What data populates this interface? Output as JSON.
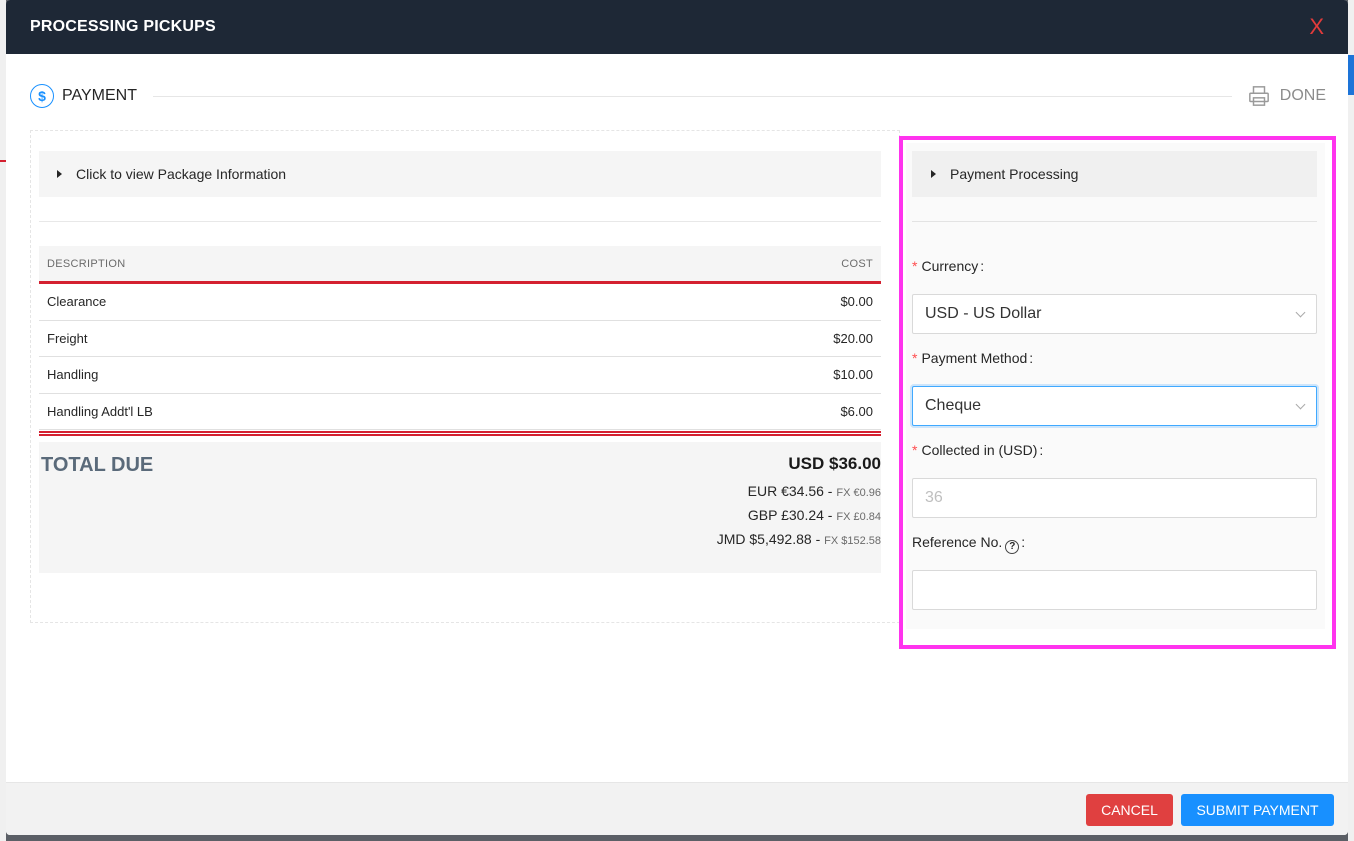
{
  "modal": {
    "title": "PROCESSING PICKUPS",
    "close_label": "X"
  },
  "steps": {
    "current_label": "PAYMENT",
    "current_icon": "dollar-icon",
    "done_label": "DONE",
    "done_icon": "printer-icon"
  },
  "package_info": {
    "header": "Click to view Package Information"
  },
  "table": {
    "columns": [
      "DESCRIPTION",
      "COST"
    ],
    "rows": [
      {
        "description": "Clearance",
        "cost": "$0.00"
      },
      {
        "description": "Freight",
        "cost": "$20.00"
      },
      {
        "description": "Handling",
        "cost": "$10.00"
      },
      {
        "description": "Handling Addt'l LB",
        "cost": "$6.00"
      }
    ]
  },
  "totals": {
    "label": "TOTAL DUE",
    "main": "USD $36.00",
    "fx": [
      {
        "amount": "EUR €34.56 -",
        "rate": "FX €0.96"
      },
      {
        "amount": "GBP £30.24 -",
        "rate": "FX £0.84"
      },
      {
        "amount": "JMD $5,492.88 -",
        "rate": "FX $152.58"
      }
    ]
  },
  "payment": {
    "header": "Payment Processing",
    "currency_label": "Currency",
    "currency_value": "USD - US Dollar",
    "method_label": "Payment Method",
    "method_value": "Cheque",
    "collected_label": "Collected in (USD)",
    "collected_placeholder": "36",
    "reference_label": "Reference No.",
    "reference_placeholder": "",
    "required_mark": "*",
    "colon": ":"
  },
  "footer": {
    "cancel_label": "CANCEL",
    "submit_label": "SUBMIT PAYMENT"
  },
  "colors": {
    "header_bg": "#1e2836",
    "accent_red": "#d42030",
    "primary_blue": "#1890ff",
    "highlight": "#ff33ee"
  }
}
